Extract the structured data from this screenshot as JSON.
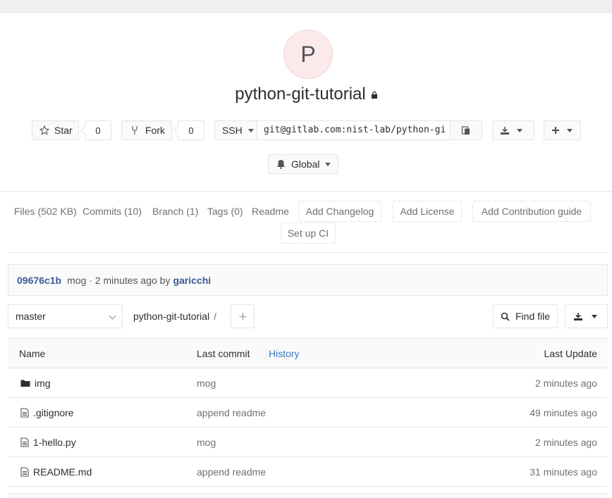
{
  "project": {
    "avatar_letter": "P",
    "name": "python-git-tutorial"
  },
  "actions": {
    "star_label": "Star",
    "star_count": "0",
    "fork_label": "Fork",
    "fork_count": "0",
    "protocol_label": "SSH",
    "clone_url": "git@gitlab.com:nist-lab/python-gi",
    "notification_label": "Global"
  },
  "nav": {
    "files": "Files (502 KB)",
    "commits": "Commits (10)",
    "branch": "Branch (1)",
    "tags": "Tags (0)",
    "readme": "Readme",
    "add_changelog": "Add Changelog",
    "add_license": "Add License",
    "add_contribution": "Add Contribution guide",
    "setup_ci": "Set up CI"
  },
  "last_commit": {
    "sha": "09676c1b",
    "message": "mog",
    "time": "· 2 minutes ago by",
    "author": "garicchi"
  },
  "tree": {
    "branch": "master",
    "path_root": "python-git-tutorial",
    "path_sep": "/",
    "find_file": "Find file"
  },
  "table": {
    "col_name": "Name",
    "col_last_commit": "Last commit",
    "col_history": "History",
    "col_last_update": "Last Update",
    "rows": [
      {
        "name": "img",
        "type": "folder",
        "message": "mog",
        "updated": "2 minutes ago"
      },
      {
        "name": ".gitignore",
        "type": "file",
        "message": "append readme",
        "updated": "49 minutes ago"
      },
      {
        "name": "1-hello.py",
        "type": "file",
        "message": "mog",
        "updated": "2 minutes ago"
      },
      {
        "name": "README.md",
        "type": "file",
        "message": "append readme",
        "updated": "31 minutes ago"
      }
    ]
  }
}
